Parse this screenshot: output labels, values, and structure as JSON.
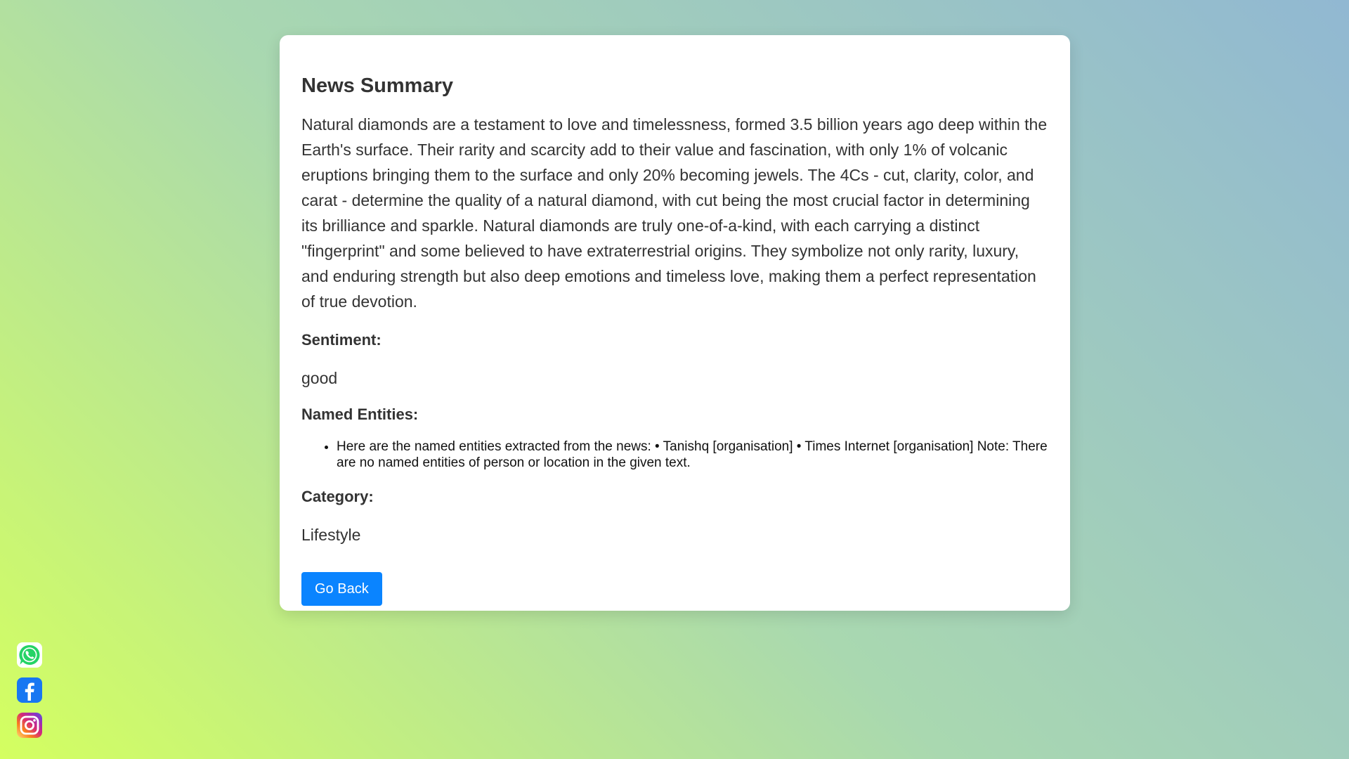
{
  "card": {
    "title": "News Summary",
    "summary": "Natural diamonds are a testament to love and timelessness, formed 3.5 billion years ago deep within the Earth's surface. Their rarity and scarcity add to their value and fascination, with only 1% of volcanic eruptions bringing them to the surface and only 20% becoming jewels. The 4Cs - cut, clarity, color, and carat - determine the quality of a natural diamond, with cut being the most crucial factor in determining its brilliance and sparkle. Natural diamonds are truly one-of-a-kind, with each carrying a distinct \"fingerprint\" and some believed to have extraterrestrial origins. They symbolize not only rarity, luxury, and enduring strength but also deep emotions and timeless love, making them a perfect representation of true devotion.",
    "sentiment_label": "Sentiment:",
    "sentiment_value": "good",
    "entities_label": "Named Entities:",
    "entities": [
      "Here are the named entities extracted from the news: • Tanishq [organisation] • Times Internet [organisation] Note: There are no named entities of person or location in the given text."
    ],
    "category_label": "Category:",
    "category_value": "Lifestyle",
    "back_button": "Go Back"
  },
  "social": [
    {
      "icon": "whatsapp-icon",
      "color": "#25d366"
    },
    {
      "icon": "facebook-icon",
      "color": "#1877f2"
    },
    {
      "icon": "instagram-icon",
      "color": "#e1306c"
    }
  ],
  "colors": {
    "accent": "#0a84ff",
    "text": "#333333",
    "card": "#ffffff"
  }
}
